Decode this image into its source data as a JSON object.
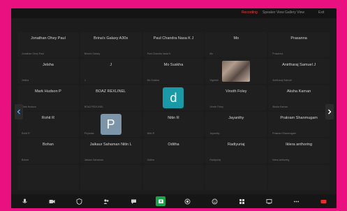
{
  "window": {
    "top_items": [
      "Recording",
      "Speaker View",
      "Gallery View",
      "Exit"
    ]
  },
  "participants": [
    {
      "name": "Jonathan Ohey Paul",
      "label": "Jonathan Ohey Paul"
    },
    {
      "name": "Brina's Galaxy A30s",
      "label": "Brina's Galaxy"
    },
    {
      "name": "Paul Chandra Nasa K J",
      "label": "Paul Chandra Nasa K"
    },
    {
      "name": "Mo",
      "label": "Mo"
    },
    {
      "name": "Prasanna",
      "label": "Prasanna"
    },
    {
      "name": "Jelsha",
      "label": "Jelsha"
    },
    {
      "name": "J",
      "label": "J"
    },
    {
      "name": "Mo Suskha",
      "label": "Mo Suskha"
    },
    {
      "name": "",
      "label": "Vignesh",
      "photo": true
    },
    {
      "name": "Anirtharaj Samuel J",
      "label": "Anirtharaj Samuel"
    },
    {
      "name": "Mark Hudson P",
      "label": "Mark Hudson"
    },
    {
      "name": "BOAZ REXLINEL",
      "label": "BOAZ REXLINEL"
    },
    {
      "name": "",
      "label": "",
      "avatar": "d",
      "avatar_color": "#1a9aa6"
    },
    {
      "name": "Vinoth Foley",
      "label": "Vinoth Foley"
    },
    {
      "name": "Aksha Karnan",
      "label": "Aksha Karnan"
    },
    {
      "name": "Rohit R",
      "label": "Rohit R"
    },
    {
      "name": "",
      "label": "Priyanka",
      "avatar": "P",
      "avatar_color": "#7c95a8"
    },
    {
      "name": "Nitin R",
      "label": "Nitin R"
    },
    {
      "name": "Jayanthy",
      "label": "Jayanthy"
    },
    {
      "name": "Prakram Shanmugam",
      "label": "Prakram Shanmugam"
    },
    {
      "name": "Bohan",
      "label": "Bohan"
    },
    {
      "name": "Jaikaur Sahaman Nitin L",
      "label": "Jaikaur Sahaman"
    },
    {
      "name": "Oditha",
      "label": "Oditha"
    },
    {
      "name": "Radiyuriaj",
      "label": "Radiyuriaj"
    },
    {
      "name": "Iklera anthoring",
      "label": "Iklera anthoring"
    },
    {
      "name": "",
      "label": ""
    },
    {
      "name": "",
      "label": ""
    },
    {
      "name": "",
      "label": ""
    },
    {
      "name": "",
      "label": ""
    },
    {
      "name": "",
      "label": ""
    }
  ],
  "toolbar": {
    "tools": [
      "mic-icon",
      "video-icon",
      "security-icon",
      "participants-icon",
      "chat-icon",
      "share-screen-icon",
      "record-icon",
      "reactions-icon",
      "apps-icon",
      "whiteboard-icon",
      "more-icon",
      "leave-icon"
    ]
  },
  "colors": {
    "frame": "#e8117f",
    "share_accent": "#1aa34a"
  }
}
